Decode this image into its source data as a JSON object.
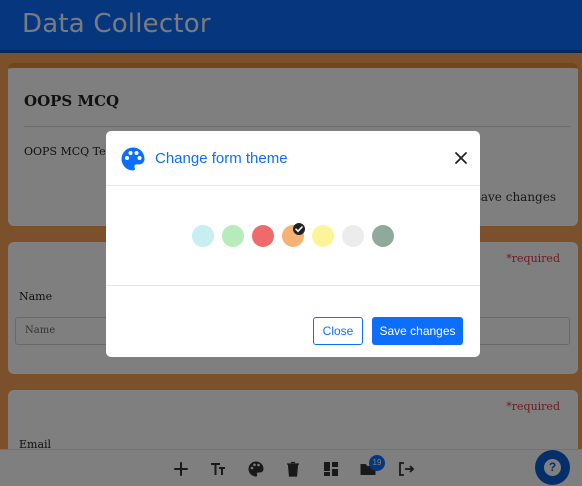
{
  "app": {
    "title": "Data Collector"
  },
  "form": {
    "title": "OOPS MCQ",
    "description": "OOPS MCQ Test",
    "save_label": "save changes"
  },
  "questions": [
    {
      "required": "*required",
      "label": "Name",
      "placeholder": "Name"
    },
    {
      "required": "*required",
      "label": "Email"
    }
  ],
  "toolbar": {
    "icons": [
      "plus-icon",
      "text-size-icon",
      "palette-icon",
      "trash-icon",
      "layout-icon",
      "folder-icon",
      "logout-icon"
    ],
    "badge_count": "19"
  },
  "modal": {
    "title": "Change form theme",
    "close_label": "Close",
    "save_label": "Save changes",
    "swatches": [
      "#c7eef0",
      "#b6ecb9",
      "#ef6b6b",
      "#f6b274",
      "#fdf49a",
      "#ececec",
      "#8faa9b"
    ],
    "selected_index": 3
  },
  "colors": {
    "accent": "#0d6efd",
    "page_bg": "#f6a259",
    "required": "#dc3545"
  }
}
